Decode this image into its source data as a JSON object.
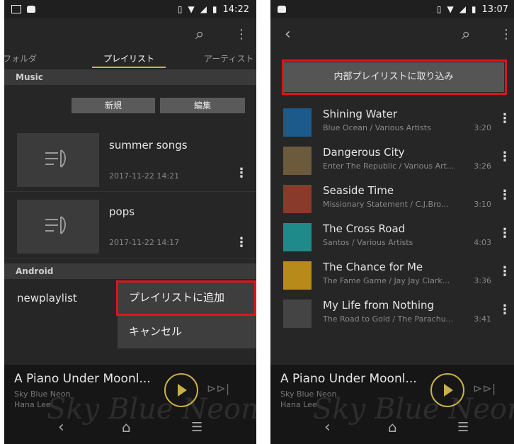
{
  "left": {
    "status": {
      "time": "14:22"
    },
    "tabs": [
      {
        "label": "フォルダ"
      },
      {
        "label": "プレイリスト"
      },
      {
        "label": "アーティスト"
      }
    ],
    "music_header": "Music",
    "new_button": "新規",
    "edit_button": "編集",
    "playlists": [
      {
        "name": "summer songs",
        "date": "2017-11-22 14:21"
      },
      {
        "name": "pops",
        "date": "2017-11-22 14:17"
      }
    ],
    "android_header": "Android",
    "android_playlist": "newplaylist",
    "menu": {
      "add": "プレイリストに追加",
      "cancel": "キャンセル"
    },
    "player": {
      "song": "A Piano Under Moonl...",
      "album": "Sky Blue Neon",
      "artist": "Hana Lee"
    }
  },
  "right": {
    "status": {
      "time": "13:07"
    },
    "import_button": "内部プレイリストに取り込み",
    "tracks": [
      {
        "title": "Shining Water",
        "subtitle": "Blue Ocean / Various Artists",
        "duration": "3:20",
        "art_color": "#1b5a8a"
      },
      {
        "title": "Dangerous City",
        "subtitle": "Enter The Republic / Various Art...",
        "duration": "3:26",
        "art_color": "#6b5a3c"
      },
      {
        "title": "Seaside Time",
        "subtitle": "Missionary Statement / C.J.Bro...",
        "duration": "3:10",
        "art_color": "#8a3a2a"
      },
      {
        "title": "The Cross Road",
        "subtitle": "Santos / Various Artists",
        "duration": "4:03",
        "art_color": "#1e8a8a"
      },
      {
        "title": "The Chance for Me",
        "subtitle": "The Fame Game / Jay Jay Clark...",
        "duration": "3:36",
        "art_color": "#b88a1a"
      },
      {
        "title": "My Life from Nothing",
        "subtitle": "The Road to Gold / The Parachu...",
        "duration": "3:41",
        "art_color": "#444444"
      }
    ],
    "player": {
      "song": "A Piano Under Moonl...",
      "album": "Sky Blue Neon",
      "artist": "Hana Lee"
    }
  },
  "colors": {
    "accent": "#c9b04a",
    "highlight_red": "#e0141c"
  }
}
